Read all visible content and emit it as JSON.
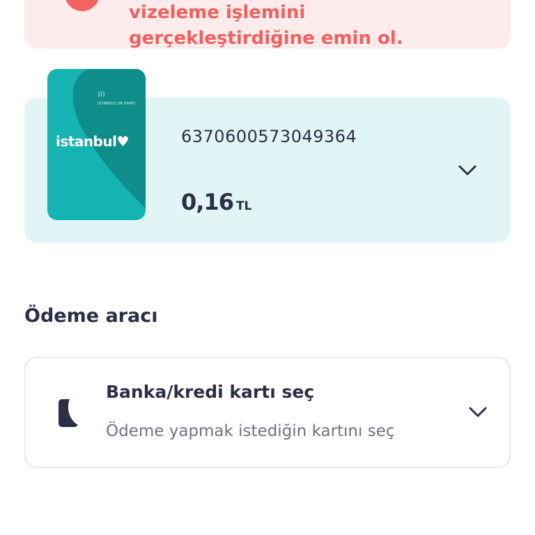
{
  "warning": {
    "text": "vizeleme işlemini\ngerçekleştirdiğine emin ol."
  },
  "card": {
    "brand_logo": "istanbul♥",
    "brand_caption": "İSTANBUL'UN KARTI",
    "number": "6370600573049364",
    "balance": "0,16",
    "currency": "TL",
    "expand_icon": "chevron-down-icon",
    "colors": {
      "panel": "#e1f5f6",
      "card": "#15b3b2",
      "card_shade": "#0e8d8b"
    }
  },
  "payment": {
    "section_title": "Ödeme aracı",
    "option_title": "Banka/kredi kartı seç",
    "option_subtitle": "Ödeme yapmak istediğin kartını seç",
    "icon": "card-icon",
    "expand_icon": "chevron-down-icon"
  },
  "colors": {
    "warning_bg": "#fdeceb",
    "warning_text": "#f0605e",
    "text": "#2b2f45"
  }
}
